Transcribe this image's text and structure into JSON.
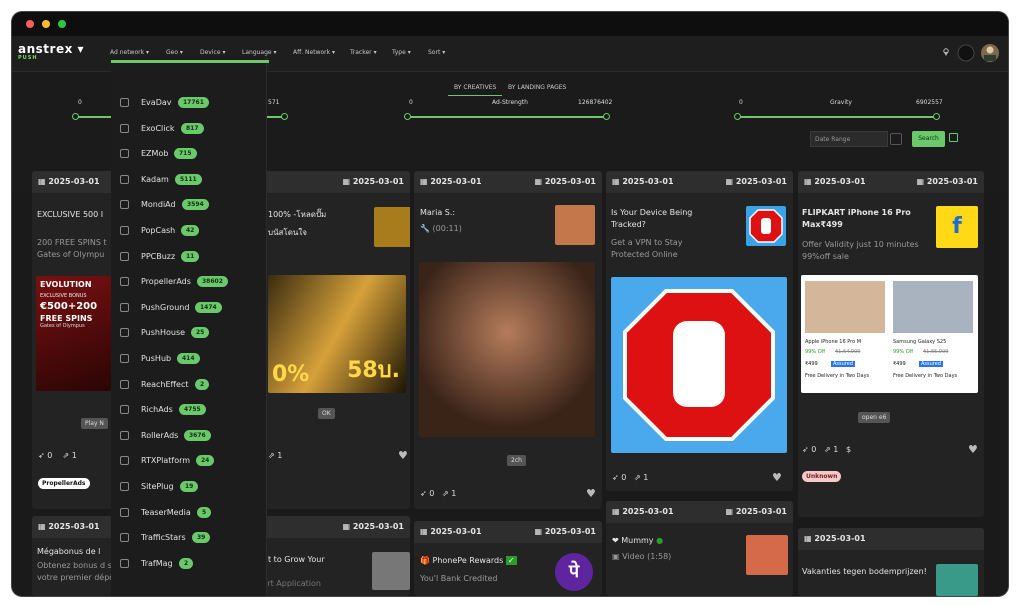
{
  "logo": {
    "name": "anstrex",
    "sub": "PUSH"
  },
  "nav": [
    "Ad network",
    "Geo",
    "Device",
    "Language",
    "Aff. Network",
    "Tracker",
    "Type",
    "Sort"
  ],
  "tabs": [
    "BY CREATIVES",
    "BY LANDING PAGES"
  ],
  "sliders": [
    {
      "min": "",
      "max": "571",
      "label": ""
    },
    {
      "min": "0",
      "max": "126876402",
      "label": "Ad-Strength"
    },
    {
      "min": "0",
      "max": "6902557",
      "label": "Gravity"
    }
  ],
  "first_slider_min": "0",
  "date_range_placeholder": "Date Range",
  "search_label": "Search",
  "dropdown": {
    "items": [
      {
        "label": "EvaDav",
        "count": "17761"
      },
      {
        "label": "ExoClick",
        "count": "817"
      },
      {
        "label": "EZMob",
        "count": "715"
      },
      {
        "label": "Kadam",
        "count": "5111"
      },
      {
        "label": "MondiAd",
        "count": "3594"
      },
      {
        "label": "PopCash",
        "count": "42"
      },
      {
        "label": "PPCBuzz",
        "count": "11"
      },
      {
        "label": "PropellerAds",
        "count": "38602"
      },
      {
        "label": "PushGround",
        "count": "1474"
      },
      {
        "label": "PushHouse",
        "count": "25"
      },
      {
        "label": "PusHub",
        "count": "414"
      },
      {
        "label": "ReachEffect",
        "count": "2"
      },
      {
        "label": "RichAds",
        "count": "4755"
      },
      {
        "label": "RollerAds",
        "count": "3676"
      },
      {
        "label": "RTXPlatform",
        "count": "24"
      },
      {
        "label": "SitePlug",
        "count": "19"
      },
      {
        "label": "TeaserMedia",
        "count": "5"
      },
      {
        "label": "TrafficStars",
        "count": "39"
      },
      {
        "label": "TrafMag",
        "count": "2"
      }
    ],
    "apply_hint": "Click to Start Application"
  },
  "cards": [
    {
      "date": "2025-03-01",
      "title": "EXCLUSIVE 500 I",
      "body": "200 FREE SPINS t Gates of Olympu",
      "badge": "PropellerAds",
      "stat1": "0",
      "stat2": "1",
      "btn": "Play N"
    },
    {
      "date": "2025-03-01",
      "title": "100% -โหลดปั๊ม",
      "body": "บนัสโดนใจ",
      "badge": "",
      "stat1": "",
      "stat2": "1",
      "btn": "OK"
    },
    {
      "date": "2025-03-01",
      "title": "Maria S.:",
      "body": "(00:11)",
      "badge": "",
      "stat1": "0",
      "stat2": "1",
      "btn": "2ch"
    },
    {
      "date": "2025-03-01",
      "title": "Is Your Device Being Tracked?",
      "body": "Get a VPN to Stay Protected Online",
      "badge": "",
      "stat1": "0",
      "stat2": "1",
      "btn": ""
    },
    {
      "date": "2025-03-01",
      "title": "FLIPKART iPhone 16 Pro Max₹499",
      "body": "Offer Validity just 10 minutes 99%off sale",
      "badge": "Unknown",
      "stat1": "0",
      "stat2": "1",
      "btn": "open e6"
    }
  ],
  "row2": [
    {
      "date": "2025-03-01",
      "title": "Mégabonus de l",
      "body": "Obtenez bonus d sur votre premier dépôt"
    },
    {
      "date": "2025-03-01",
      "title": "t to Grow Your",
      "body": ""
    },
    {
      "date": "2025-03-01",
      "title": "PhonePe Rewards",
      "body": "You'l  Bank Credited"
    },
    {
      "date": "2025-03-01",
      "title": "Mummy",
      "body": "Video (1:58)"
    },
    {
      "date": "2025-03-01",
      "title": "Vakanties tegen bodemprijzen!",
      "body": ""
    }
  ],
  "phone_cards": [
    {
      "name": "Apple iPhone 16 Pro M",
      "pct": "99% Off",
      "old": "₹1,64,900",
      "price": "₹499",
      "tag": "Assured",
      "ship": "Free Delivery in Two Days"
    },
    {
      "name": "Samsung Galaxy S25",
      "pct": "99% Off",
      "old": "₹1,65,999",
      "price": "₹499",
      "tag": "Assured",
      "ship": "Free Delivery in Two Days"
    }
  ],
  "evolution": {
    "brand": "EVOLUTION",
    "amount": "€500+200",
    "spins": "FREE SPINS",
    "sub": "Gates of Olympus",
    "bonus": "EXCLUSIVE BONUS"
  },
  "casino": {
    "pct": "0%",
    "baht": "58บ."
  },
  "colors": {
    "accent": "#6ac96a",
    "bg": "#1a1a1a",
    "card": "#232323"
  }
}
